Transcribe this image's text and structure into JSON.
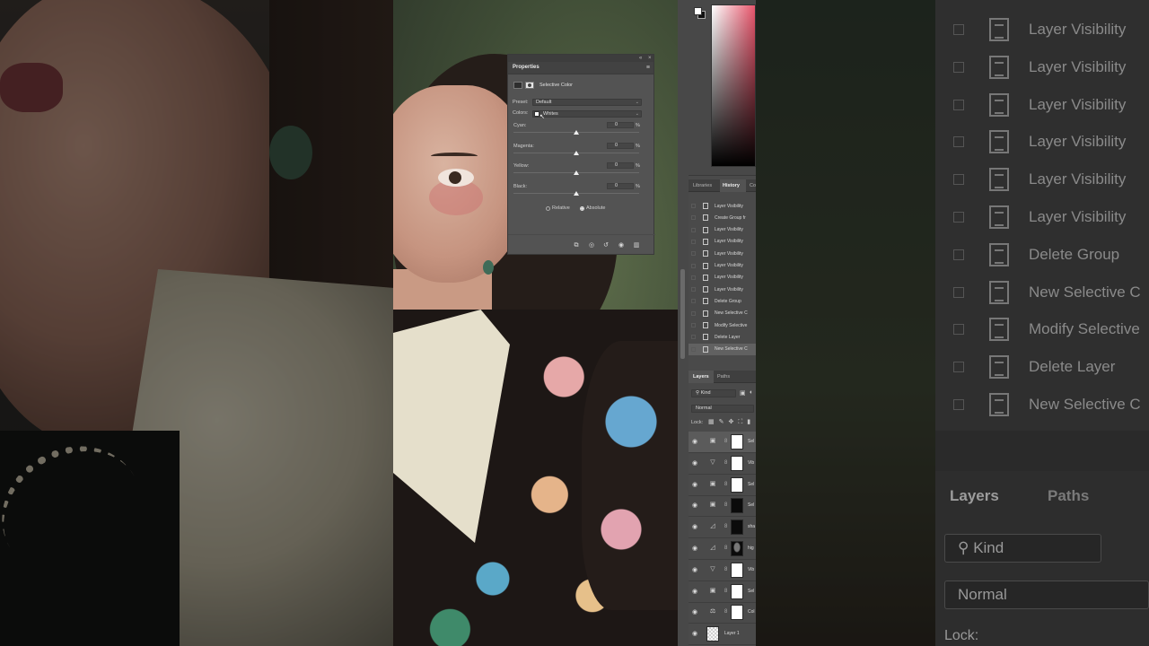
{
  "properties_panel": {
    "tab_title": "Properties",
    "adjustment_name": "Selective Color",
    "preset_label": "Preset:",
    "preset_value": "Default",
    "colors_label": "Colors:",
    "colors_value": "Whites",
    "sliders": [
      {
        "label": "Cyan:",
        "value": "0",
        "unit": "%"
      },
      {
        "label": "Magenta:",
        "value": "0",
        "unit": "%"
      },
      {
        "label": "Yellow:",
        "value": "0",
        "unit": "%"
      },
      {
        "label": "Black:",
        "value": "0",
        "unit": "%"
      }
    ],
    "method_options": [
      "Relative",
      "Absolute"
    ],
    "method_selected": "Absolute",
    "collapse_glyph": "«",
    "close_glyph": "×",
    "menu_glyph": "≡",
    "footer_icons": [
      "clip-to-layer-icon",
      "view-previous-icon",
      "reset-icon",
      "visibility-icon",
      "trash-icon"
    ]
  },
  "right_panel": {
    "foreground_color": "#ffffff",
    "background_color": "#111111",
    "history_tabs": [
      "Libraries",
      "History",
      "Co"
    ],
    "history_active": "History",
    "history_items": [
      "Layer Visibility",
      "Create Group fr",
      "Layer Visibility",
      "Layer Visibility",
      "Layer Visibility",
      "Layer Visibility",
      "Layer Visibility",
      "Layer Visibility",
      "Delete Group",
      "New Selective C",
      "Modify Selective",
      "Delete Layer",
      "New Selective C"
    ],
    "layers_tabs": [
      "Layers",
      "Paths"
    ],
    "layers_active": "Layers",
    "kind_filter": "Kind",
    "blend_mode": "Normal",
    "lock_label": "Lock:",
    "layers": [
      {
        "name": "Sel",
        "icon": "selective-color-icon",
        "thumb": "white",
        "selected": true
      },
      {
        "name": "Vib",
        "icon": "vibrance-icon",
        "thumb": "white",
        "selected": false
      },
      {
        "name": "Sel",
        "icon": "selective-color-icon",
        "thumb": "white",
        "selected": false
      },
      {
        "name": "Sel",
        "icon": "selective-color-icon",
        "thumb": "black",
        "selected": false
      },
      {
        "name": "sha",
        "icon": "curves-icon",
        "thumb": "black",
        "selected": false
      },
      {
        "name": "hig",
        "icon": "curves-icon",
        "thumb": "figure",
        "selected": false
      },
      {
        "name": "Vib",
        "icon": "vibrance-icon",
        "thumb": "white",
        "selected": false
      },
      {
        "name": "Sel",
        "icon": "selective-color-icon",
        "thumb": "white",
        "selected": false
      },
      {
        "name": "Col",
        "icon": "color-balance-icon",
        "thumb": "white",
        "selected": false
      },
      {
        "name": "Layer 1",
        "icon": "",
        "thumb": "checker",
        "selected": false
      }
    ]
  },
  "background_enlarged": {
    "history_items": [
      "Layer Visibility",
      "Layer Visibility",
      "Layer Visibility",
      "Layer Visibility",
      "Layer Visibility",
      "Layer Visibility",
      "Delete Group",
      "New Selective C",
      "Modify Selective",
      "Delete Layer",
      "New Selective C"
    ],
    "layers_tab": "Layers",
    "paths_tab": "Paths",
    "kind_filter": "Kind",
    "blend_mode": "Normal",
    "lock_label": "Lock:"
  }
}
